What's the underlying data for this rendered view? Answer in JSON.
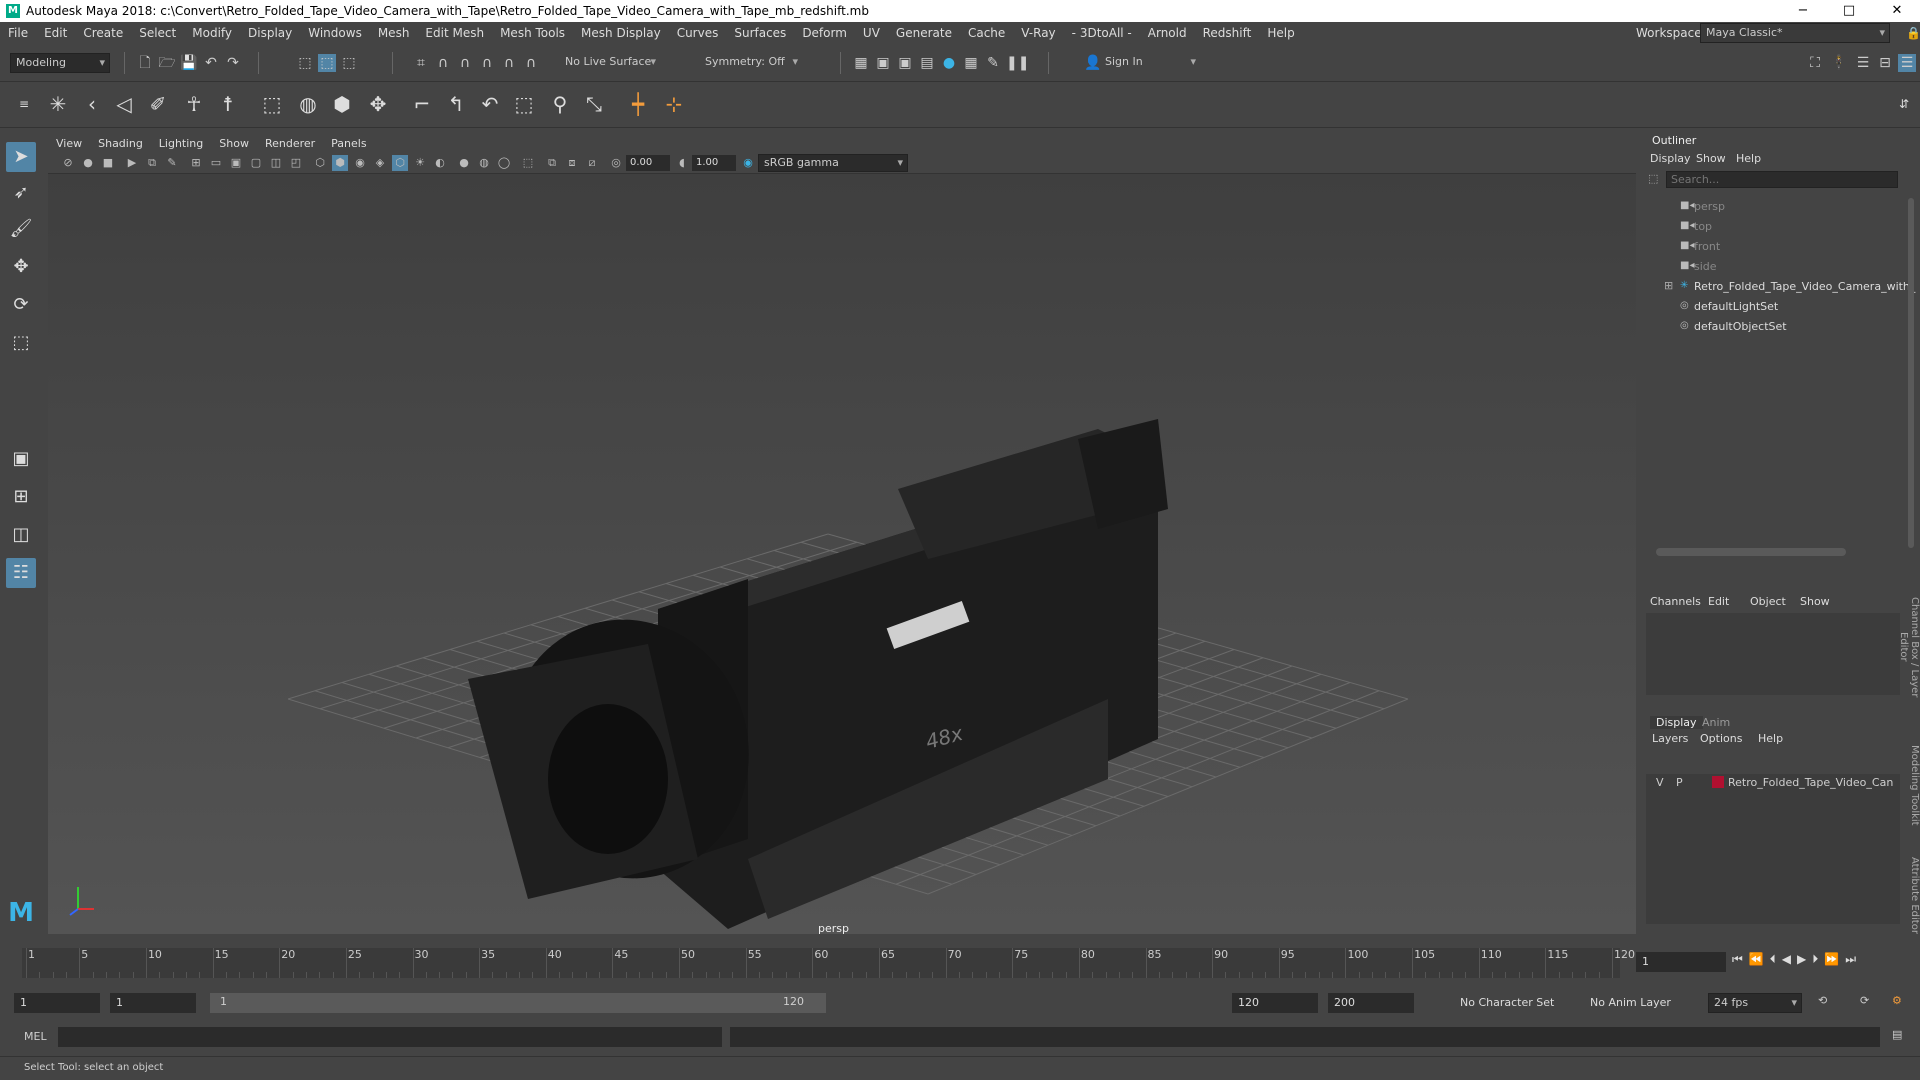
{
  "titlebar": {
    "title": "Autodesk Maya 2018: c:\\Convert\\Retro_Folded_Tape_Video_Camera_with_Tape\\Retro_Folded_Tape_Video_Camera_with_Tape_mb_redshift.mb",
    "minimize": "−",
    "maximize": "□",
    "close": "✕"
  },
  "menubar": [
    "File",
    "Edit",
    "Create",
    "Select",
    "Modify",
    "Display",
    "Windows",
    "Mesh",
    "Edit Mesh",
    "Mesh Tools",
    "Mesh Display",
    "Curves",
    "Surfaces",
    "Deform",
    "UV",
    "Generate",
    "Cache",
    "V-Ray",
    "- 3DtoAll -",
    "Arnold",
    "Redshift",
    "Help"
  ],
  "workspace": {
    "label": "Workspace :",
    "value": "Maya Classic*"
  },
  "status": {
    "mode": "Modeling",
    "live_surface": "No Live Surface",
    "symmetry": "Symmetry: Off",
    "sign_in": "Sign In"
  },
  "viewport": {
    "menu": [
      "View",
      "Shading",
      "Lighting",
      "Show",
      "Renderer",
      "Panels"
    ],
    "exposure": "0.00",
    "gamma": "1.00",
    "color_space": "sRGB gamma",
    "camera_label": "persp",
    "model_label": "48x"
  },
  "outliner": {
    "title": "Outliner",
    "menu": [
      "Display",
      "Show",
      "Help"
    ],
    "search_placeholder": "Search...",
    "items": [
      {
        "label": "persp",
        "dim": true
      },
      {
        "label": "top",
        "dim": true
      },
      {
        "label": "front",
        "dim": true
      },
      {
        "label": "side",
        "dim": true
      },
      {
        "label": "Retro_Folded_Tape_Video_Camera_with_",
        "dim": false
      },
      {
        "label": "defaultLightSet",
        "dim": false
      },
      {
        "label": "defaultObjectSet",
        "dim": false
      }
    ]
  },
  "channelbox": {
    "menu": [
      "Channels",
      "Edit",
      "Object",
      "Show"
    ],
    "side_tab": "Channel Box / Layer Editor"
  },
  "layers": {
    "tabs": [
      "Display",
      "Anim"
    ],
    "menu": [
      "Layers",
      "Options",
      "Help"
    ],
    "row": {
      "v": "V",
      "p": "P",
      "name": "Retro_Folded_Tape_Video_Can"
    },
    "layer_color": "#b01030"
  },
  "side_tabs": [
    "Modeling Toolkit",
    "Attribute Editor"
  ],
  "timeline": {
    "ticks": [
      "1",
      "5",
      "10",
      "15",
      "20",
      "25",
      "30",
      "35",
      "40",
      "45",
      "50",
      "55",
      "60",
      "65",
      "70",
      "75",
      "80",
      "85",
      "90",
      "95",
      "100",
      "105",
      "110",
      "115",
      "120"
    ],
    "current": "1"
  },
  "range": {
    "start": "1",
    "start2": "1",
    "slider_start": "1",
    "slider_end": "120",
    "end": "120",
    "end2": "200",
    "char_set": "No Character Set",
    "anim_layer": "No Anim Layer",
    "fps": "24 fps"
  },
  "mel": {
    "label": "MEL"
  },
  "help": "Select Tool: select an object"
}
